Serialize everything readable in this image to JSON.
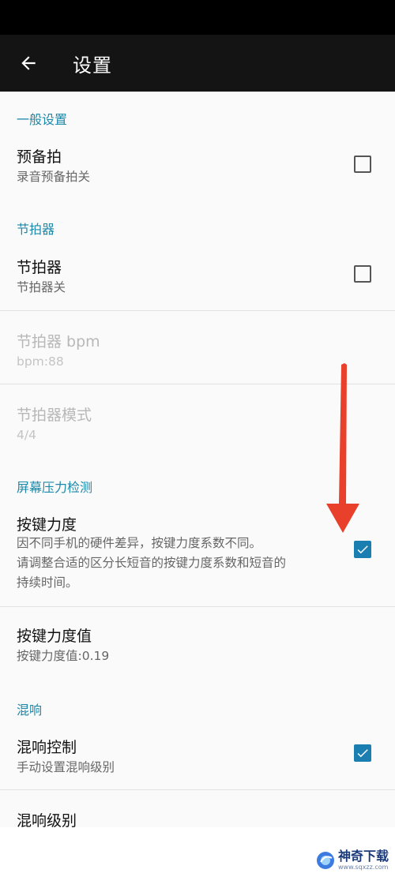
{
  "app_bar": {
    "title": "设置",
    "back_icon": "arrow-left-icon"
  },
  "sections": {
    "general": {
      "header": "一般设置"
    },
    "metronome": {
      "header": "节拍器"
    },
    "pressure": {
      "header": "屏幕压力检测"
    },
    "reverb": {
      "header": "混响"
    }
  },
  "items": {
    "count_in": {
      "title": "预备拍",
      "summary": "录音预备拍关",
      "checked": false
    },
    "metronome": {
      "title": "节拍器",
      "summary": "节拍器关",
      "checked": false
    },
    "metronome_bpm": {
      "title": "节拍器 bpm",
      "summary": "bpm:88",
      "enabled": false
    },
    "metronome_mode": {
      "title": "节拍器模式",
      "summary": "4/4",
      "enabled": false
    },
    "key_force": {
      "title": "按键力度",
      "summary_line1": "因不同手机的硬件差异，按键力度系数不同。",
      "summary_line2": "请调整合适的区分长短音的按键力度系数和短音的",
      "summary_line3": "持续时间。",
      "checked": true
    },
    "key_force_value": {
      "title": "按键力度值",
      "summary": "按键力度值:0.19"
    },
    "reverb_control": {
      "title": "混响控制",
      "summary": "手动设置混响级别",
      "checked": true
    },
    "reverb_level": {
      "title": "混响级别"
    }
  },
  "colors": {
    "accent": "#1a7fb0",
    "section_header": "#1e88a8",
    "annotation_arrow": "#e8402a"
  },
  "watermark": {
    "name": "神奇下载",
    "url": "www.sqxzz.com"
  }
}
